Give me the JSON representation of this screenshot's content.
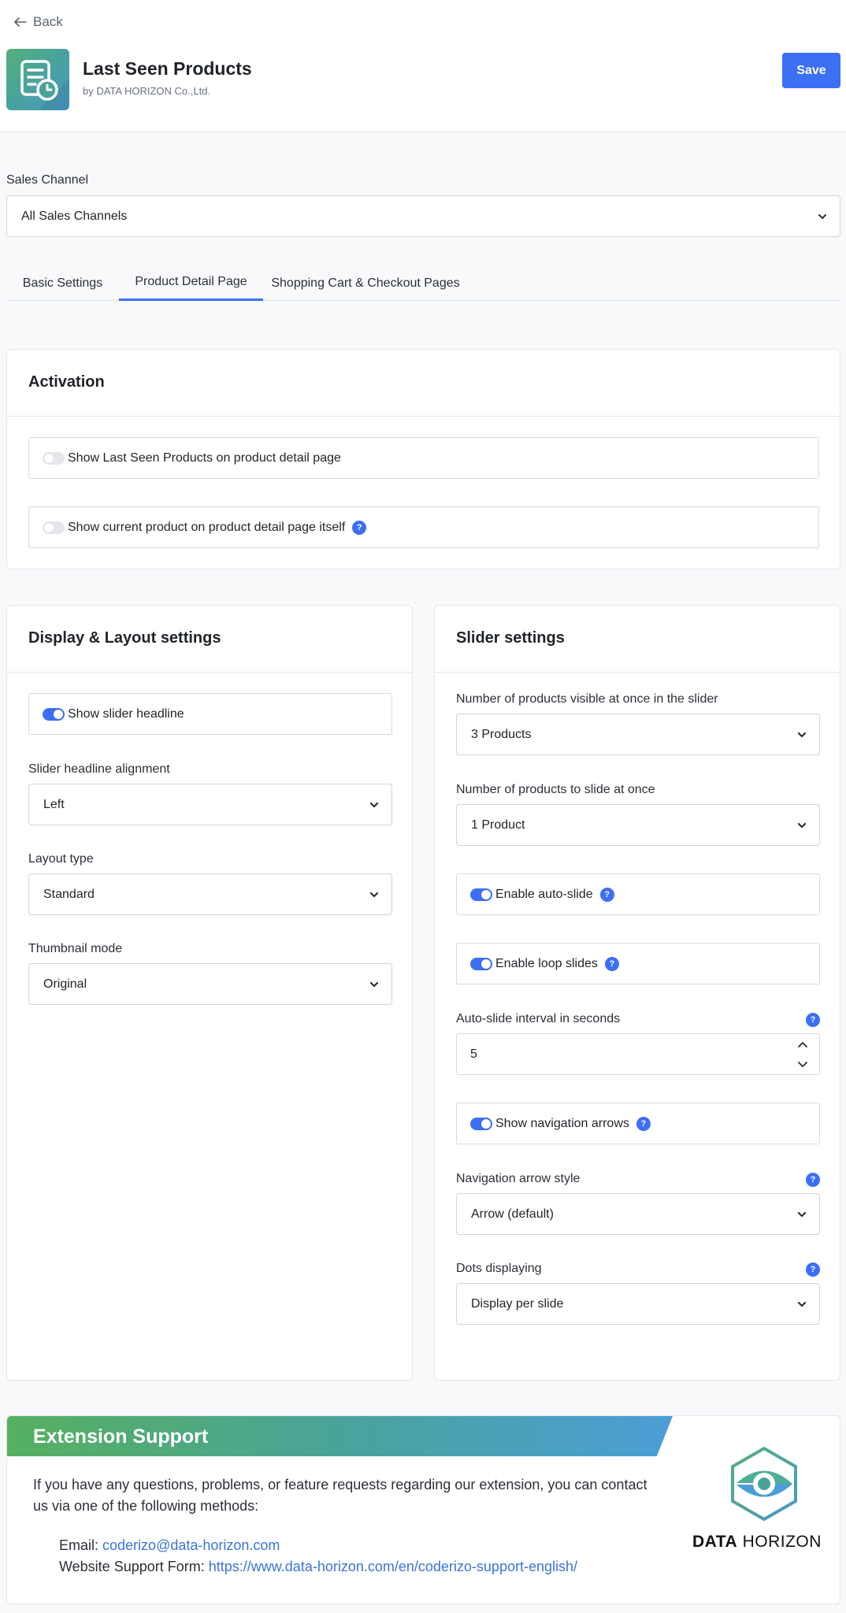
{
  "header": {
    "back_label": "Back",
    "app_title": "Last Seen Products",
    "app_subtitle": "by DATA HORIZON Co.,Ltd.",
    "save_label": "Save"
  },
  "sales_channel": {
    "label": "Sales Channel",
    "value": "All Sales Channels"
  },
  "tabs": [
    {
      "label": "Basic Settings",
      "active": false
    },
    {
      "label": "Product Detail Page",
      "active": true
    },
    {
      "label": "Shopping Cart & Checkout Pages",
      "active": false
    }
  ],
  "activation": {
    "title": "Activation",
    "options": [
      {
        "label": "Show Last Seen Products on product detail page",
        "enabled": false,
        "help": false
      },
      {
        "label": "Show current product on product detail page itself",
        "enabled": false,
        "help": true
      }
    ]
  },
  "display_layout": {
    "title": "Display & Layout settings",
    "show_headline": {
      "label": "Show slider headline",
      "enabled": true
    },
    "headline_alignment": {
      "label": "Slider headline alignment",
      "value": "Left"
    },
    "layout_type": {
      "label": "Layout type",
      "value": "Standard"
    },
    "thumbnail_mode": {
      "label": "Thumbnail mode",
      "value": "Original"
    }
  },
  "slider": {
    "title": "Slider settings",
    "visible_count": {
      "label": "Number of products visible at once in the slider",
      "value": "3 Products"
    },
    "slide_count": {
      "label": "Number of products to slide at once",
      "value": "1 Product"
    },
    "auto_slide": {
      "label": "Enable auto-slide",
      "enabled": true
    },
    "loop_slides": {
      "label": "Enable loop slides",
      "enabled": true
    },
    "interval": {
      "label": "Auto-slide interval in seconds",
      "value": "5"
    },
    "nav_arrows": {
      "label": "Show navigation arrows",
      "enabled": true
    },
    "arrow_style": {
      "label": "Navigation arrow style",
      "value": "Arrow (default)"
    },
    "dots": {
      "label": "Dots displaying",
      "value": "Display per slide"
    }
  },
  "support": {
    "title": "Extension Support",
    "intro": "If you have any questions, problems, or feature requests regarding our extension, you can contact us via one of the following methods:",
    "email_label": "Email:",
    "email": "coderizo@data-horizon.com",
    "form_label": "Website Support Form:",
    "form_url": "https://www.data-horizon.com/en/coderizo-support-english/",
    "logo_word_bold": "DATA",
    "logo_word_light": "HORIZON"
  },
  "colors": {
    "accent": "#3d6ff5",
    "link": "#3a74d8",
    "brand_green": "#55b07a",
    "brand_blue": "#4798c8"
  },
  "icons": {
    "back": "arrow-left-icon",
    "app": "document-clock-icon",
    "select": "chevron-down-icon",
    "help": "question-mark-icon",
    "stepper": "chevron-up-down-icon"
  }
}
